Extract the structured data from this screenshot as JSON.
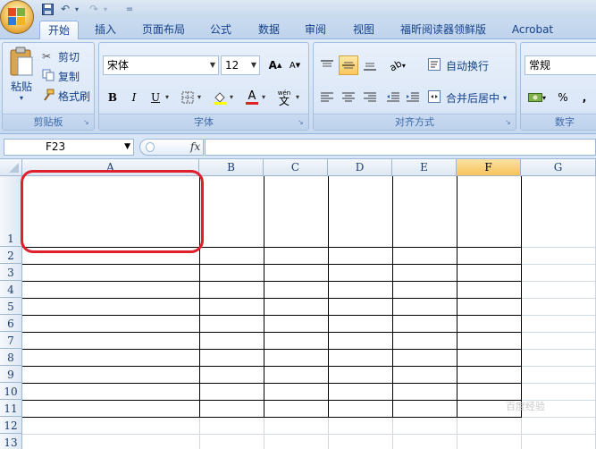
{
  "quick_access": {
    "undo_label": "↶",
    "redo_label": "↷",
    "dropdown": "="
  },
  "tabs": [
    {
      "label": "开始",
      "active": true
    },
    {
      "label": "插入"
    },
    {
      "label": "页面布局"
    },
    {
      "label": "公式"
    },
    {
      "label": "数据"
    },
    {
      "label": "审阅"
    },
    {
      "label": "视图"
    },
    {
      "label": "福昕阅读器领鲜版"
    },
    {
      "label": "Acrobat"
    }
  ],
  "clipboard": {
    "group_label": "剪贴板",
    "paste_label": "粘贴",
    "cut_label": "剪切",
    "copy_label": "复制",
    "format_painter_label": "格式刷"
  },
  "font": {
    "group_label": "字体",
    "font_name": "宋体",
    "font_size": "12",
    "grow_label": "A",
    "shrink_label": "A",
    "bold": "B",
    "italic": "I",
    "underline": "U",
    "font_color_label": "A",
    "wen_label": "wén",
    "wen_char": "文"
  },
  "alignment": {
    "group_label": "对齐方式",
    "wrap_text_label": "自动换行",
    "merge_center_label": "合并后居中"
  },
  "number": {
    "group_label": "数字",
    "format_value": "常规",
    "percent": "%",
    "comma": ","
  },
  "formula_bar": {
    "name_box": "F23",
    "fx_label": "fx",
    "formula": ""
  },
  "columns": [
    "A",
    "B",
    "C",
    "D",
    "E",
    "F",
    "G"
  ],
  "selected_column": "F",
  "rows": [
    "1",
    "2",
    "3",
    "4",
    "5",
    "6",
    "7",
    "8",
    "9",
    "10",
    "11",
    "12",
    "13"
  ],
  "watermark": "百度经验",
  "colors": {
    "highlight": "#e0202c",
    "ribbon_bg": "#dbe7f7",
    "selected_header": "#f7c35c"
  }
}
